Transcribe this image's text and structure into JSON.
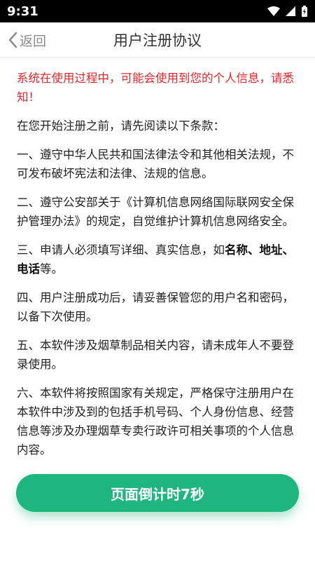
{
  "status_bar": {
    "time": "9:31"
  },
  "header": {
    "back_label": "返回",
    "title": "用户注册协议"
  },
  "content": {
    "warning": "系统在使用过程中，可能会使用到您的个人信息，请悉知！",
    "intro": "在您开始注册之前，请先阅读以下条款：",
    "clause1": "一、遵守中华人民共和国法律法令和其他相关法规，不可发布破坏宪法和法律、法规的信息。",
    "clause2": "二、遵守公安部关于《计算机信息网络国际联网安全保护管理办法》的规定，自觉维护计算机信息网络安全。",
    "clause3": {
      "pre": "三、申请人必须填写详细、真实信息，如",
      "bold": "名称、地址、电话",
      "post": "等。"
    },
    "clause4": "四、用户注册成功后，请妥善保管您的用户名和密码，以备下次使用。",
    "clause5": "五、本软件涉及烟草制品相关内容，请未成年人不要登录使用。",
    "clause6": "六、本软件将按照国家有关规定，严格保守注册用户在本软件中涉及到的包括手机号码、个人身份信息、经营信息等涉及办理烟草专卖行政许可相关事项的个人信息内容。"
  },
  "countdown_button": {
    "label": "页面倒计时7秒"
  },
  "colors": {
    "accent": "#1eb57f",
    "warning": "#e5262c"
  }
}
